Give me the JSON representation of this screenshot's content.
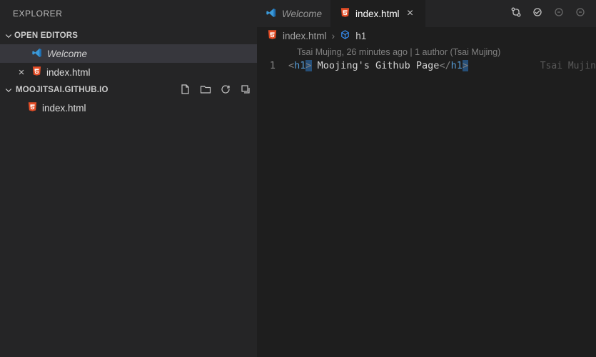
{
  "explorer": {
    "title": "EXPLORER",
    "openEditorsHeader": "OPEN EDITORS",
    "openEditors": [
      {
        "label": "Welcome",
        "italic": true,
        "icon": "vscode"
      },
      {
        "label": "index.html",
        "icon": "html5",
        "closeable": true
      }
    ],
    "folderHeader": "MOOJITSAI.GITHUB.IO",
    "files": [
      {
        "label": "index.html",
        "icon": "html5"
      }
    ]
  },
  "tabs": [
    {
      "label": "Welcome",
      "icon": "vscode",
      "active": false,
      "italic": true
    },
    {
      "label": "index.html",
      "icon": "html5",
      "active": true,
      "closeable": true
    }
  ],
  "breadcrumb": {
    "file": "index.html",
    "symbol": "h1"
  },
  "blame": "Tsai Mujing, 26 minutes ago | 1 author (Tsai Mujing)",
  "code": {
    "lineNumber": "1",
    "open": "<",
    "tag": "h1",
    "gt": ">",
    "text": " Moojing's Github Page",
    "closeOpen": "</",
    "closeTag": "h1",
    "closeGt": ">"
  },
  "ghost": "Tsai Mujin"
}
